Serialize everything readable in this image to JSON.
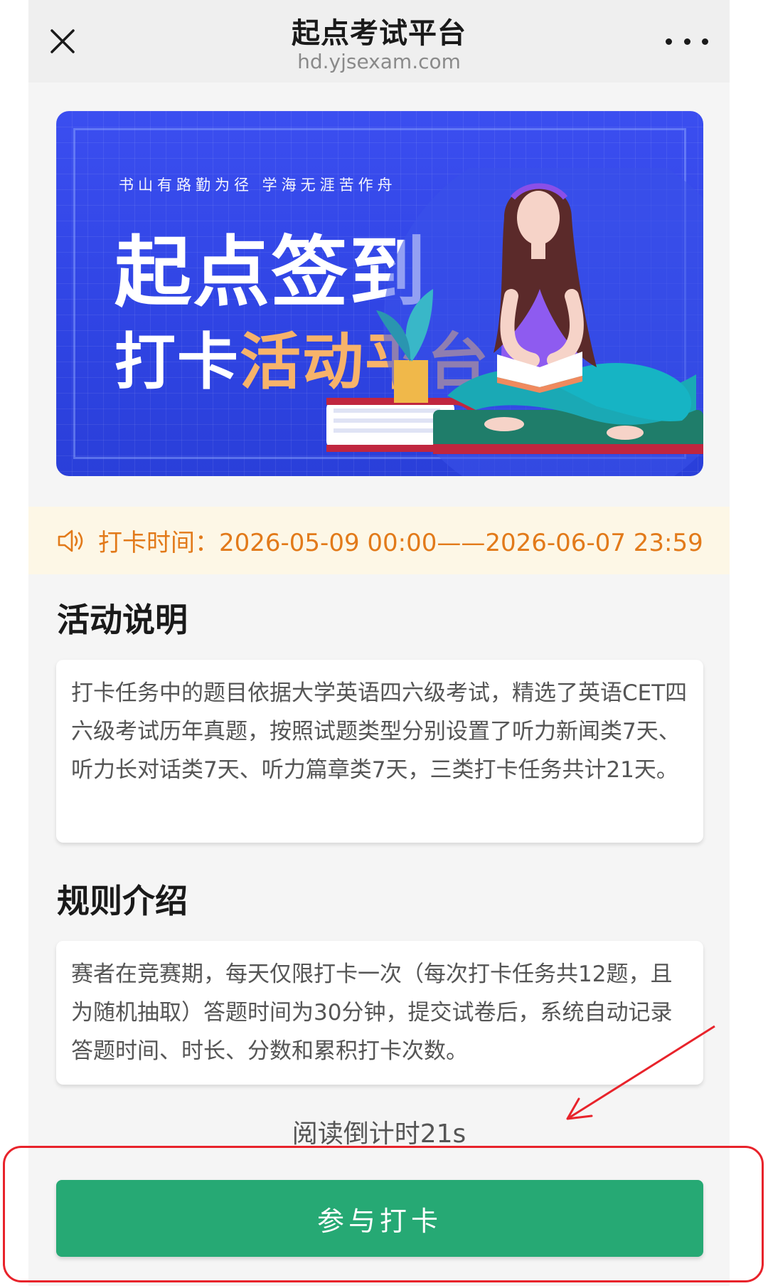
{
  "header": {
    "title": "起点考试平台",
    "url": "hd.yjsexam.com",
    "close_icon": "close-icon",
    "more_icon": "more-icon"
  },
  "banner": {
    "slogan": "书山有路勤为径 学海无涯苦作舟",
    "headline": "起点签到",
    "subline_white": "打卡",
    "subline_orange": "活动平台",
    "accent_color": "#f7b36a"
  },
  "notice": {
    "icon": "speaker-icon",
    "text": "打卡时间：2026-05-09 00:00——2026-06-07 23:59"
  },
  "activity": {
    "title": "活动说明",
    "body": "打卡任务中的题目依据大学英语四六级考试，精选了英语CET四六级考试历年真题，按照试题类型分别设置了听力新闻类7天、听力长对话类7天、听力篇章类7天，三类打卡任务共计21天。"
  },
  "rules": {
    "title": "规则介绍",
    "body": "赛者在竞赛期，每天仅限打卡一次（每次打卡任务共12题，且为随机抽取）答题时间为30分钟，提交试卷后，系统自动记录答题时间、时长、分数和累积打卡次数。"
  },
  "countdown": "阅读倒计时21s",
  "join_button": {
    "label": "参与打卡",
    "color": "#26a974"
  }
}
